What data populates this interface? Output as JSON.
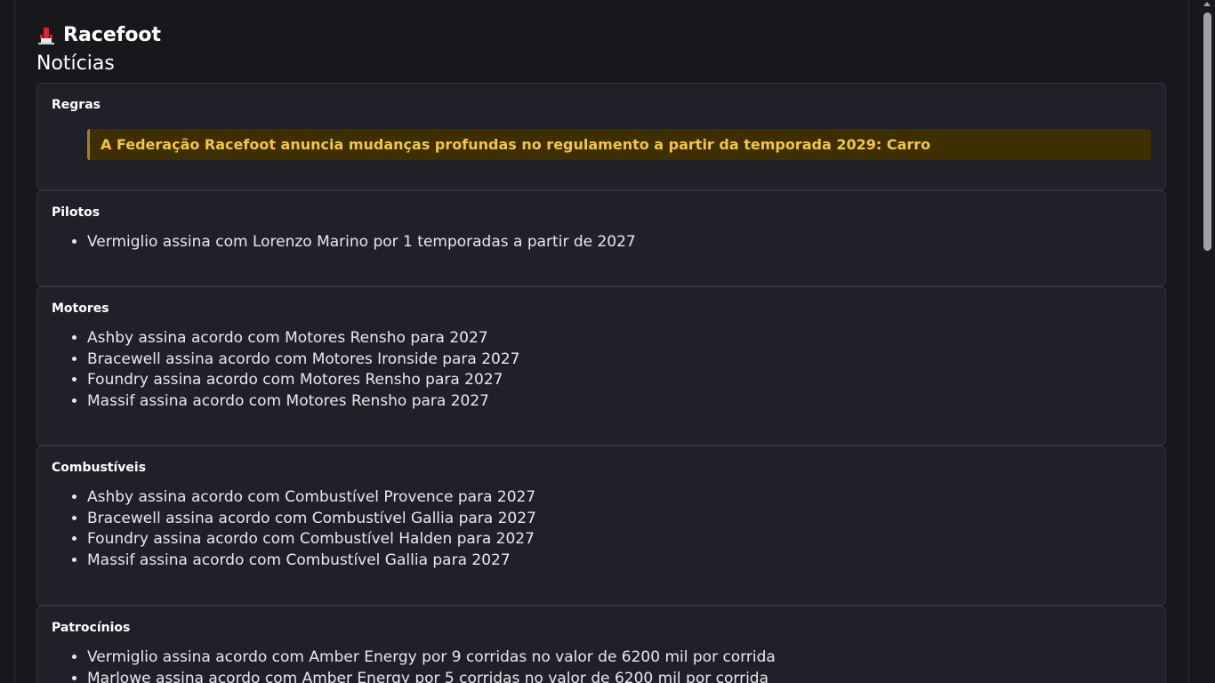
{
  "app": {
    "brand_name": "Racefoot",
    "brand_icon": "podium-icon",
    "page_title": "Notícias"
  },
  "sections": {
    "regras": {
      "title": "Regras",
      "highlight": "A Federação Racefoot anuncia mudanças profundas no regulamento a partir da temporada 2029: Carro"
    },
    "pilotos": {
      "title": "Pilotos",
      "items": [
        "Vermiglio assina com Lorenzo Marino por 1 temporadas a partir de 2027"
      ]
    },
    "motores": {
      "title": "Motores",
      "items": [
        "Ashby assina acordo com Motores Rensho para 2027",
        "Bracewell assina acordo com Motores Ironside para 2027",
        "Foundry assina acordo com Motores Rensho para 2027",
        "Massif assina acordo com Motores Rensho para 2027"
      ]
    },
    "combustiveis": {
      "title": "Combustíveis",
      "items": [
        "Ashby assina acordo com Combustível Provence para 2027",
        "Bracewell assina acordo com Combustível Gallia para 2027",
        "Foundry assina acordo com Combustível Halden para 2027",
        "Massif assina acordo com Combustível Gallia para 2027"
      ]
    },
    "patrocinios": {
      "title": "Patrocínios",
      "items": [
        "Vermiglio assina acordo com Amber Energy por 9 corridas no valor de 6200 mil por corrida",
        "Marlowe assina acordo com Amber Energy por 5 corridas no valor de 6200 mil por corrida"
      ]
    }
  },
  "colors": {
    "background": "#17171c",
    "card": "#202028",
    "highlight_bg": "#3d2f00",
    "highlight_text": "#f4c54a",
    "brand_icon_red": "#d6262b"
  }
}
